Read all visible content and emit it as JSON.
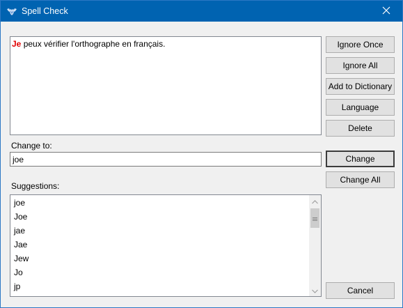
{
  "window": {
    "title": "Spell Check",
    "accent_color": "#0063b1"
  },
  "text_content": {
    "misspelled_word": "Je",
    "rest": " peux vérifier l'orthographe en français.",
    "misspelled_color": "#e00000"
  },
  "buttons": {
    "ignore_once": "Ignore Once",
    "ignore_all": "Ignore All",
    "add_to_dictionary": "Add to Dictionary",
    "language": "Language",
    "delete": "Delete",
    "change": "Change",
    "change_all": "Change All",
    "cancel": "Cancel"
  },
  "change_to": {
    "label": "Change to:",
    "value": "joe"
  },
  "suggestions": {
    "label": "Suggestions:",
    "items": [
      "joe",
      "Joe",
      "jae",
      "Jae",
      "Jew",
      "Jo",
      "jp"
    ]
  },
  "icons": {
    "app": "bat-logo-icon",
    "close": "close-icon",
    "scroll_up": "chevron-up-icon",
    "scroll_down": "chevron-down-icon",
    "scroll_grip": "grip-icon"
  }
}
